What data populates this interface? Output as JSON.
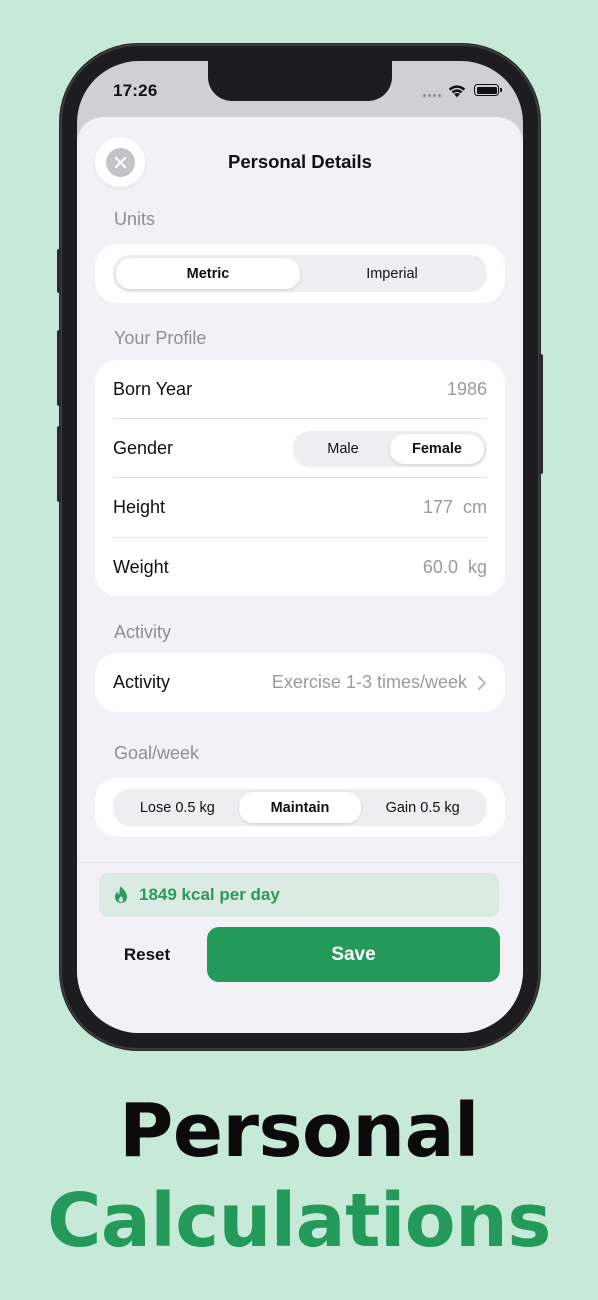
{
  "status_bar": {
    "time": "17:26"
  },
  "sheet": {
    "title": "Personal Details",
    "units": {
      "section_label": "Units",
      "options": [
        "Metric",
        "Imperial"
      ],
      "selected": "Metric"
    },
    "profile": {
      "section_label": "Your Profile",
      "born_year_label": "Born Year",
      "born_year_value": "1986",
      "gender_label": "Gender",
      "gender_options": [
        "Male",
        "Female"
      ],
      "gender_selected": "Female",
      "height_label": "Height",
      "height_value": "177",
      "height_unit": "cm",
      "weight_label": "Weight",
      "weight_value": "60.0",
      "weight_unit": "kg"
    },
    "activity": {
      "section_label": "Activity",
      "row_label": "Activity",
      "row_value": "Exercise 1-3 times/week"
    },
    "goal": {
      "section_label": "Goal/week",
      "options": [
        "Lose 0.5 kg",
        "Maintain",
        "Gain 0.5 kg"
      ],
      "selected": "Maintain"
    },
    "kcal_text": "1849 kcal per day",
    "reset_label": "Reset",
    "save_label": "Save"
  },
  "headline": {
    "line1": "Personal",
    "line2": "Calculations"
  },
  "colors": {
    "background": "#c6ead7",
    "accent_green": "#239a59",
    "kcal_banner_bg": "#dbeae3"
  }
}
